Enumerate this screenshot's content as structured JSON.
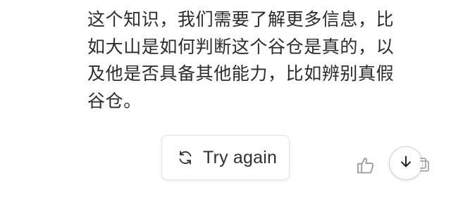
{
  "message": {
    "lines": [
      "这个知识，我们需要了解更多信息，比",
      "如大山是如何判断这个谷仓是真的，以",
      "及他是否具备其他能力，比如辨别真假",
      "谷仓。"
    ]
  },
  "actions": {
    "retry_label": "Try again",
    "retry_icon": "refresh-icon",
    "thumb_icon": "thumbs-up-icon",
    "scroll_icon": "arrow-down-icon"
  }
}
